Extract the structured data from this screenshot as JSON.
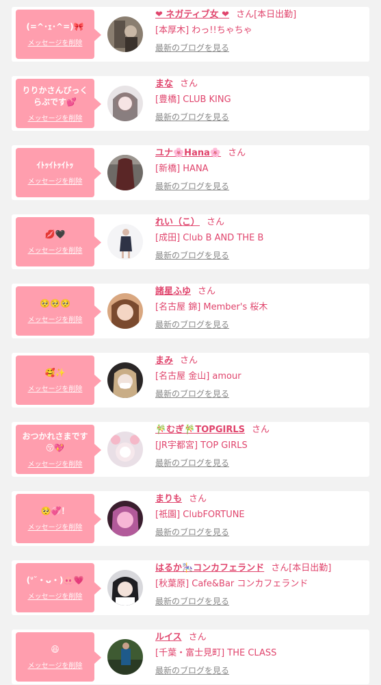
{
  "delete_label": "メッセージを削除",
  "blog_label": "最新のブログを見る",
  "san_label": "さん",
  "colors": {
    "accent": "#e0446c",
    "bubble": "#ff9eae",
    "background": "#f2f2f2",
    "muted": "#888888"
  },
  "cards": [
    {
      "message": "(=^･ｪ･^=)🎀",
      "name": "❤︎ ネガティブ女 ❤︎",
      "suffix": "さん[本日出勤]",
      "shop": "[本厚木] わっ!!ちゃちゃ"
    },
    {
      "message": "りりかさんびっくらぶです💕",
      "name": "まな",
      "suffix": "さん",
      "shop": "[豊橋] CLUB KING"
    },
    {
      "message": "ｲﾄｯｲﾄｯｲﾄｯ",
      "name": "ユナ🌸Hana🌸",
      "suffix": "さん",
      "shop": "[新橋] HANA"
    },
    {
      "message": "💋🖤",
      "name": "れい（こ）",
      "suffix": "さん",
      "shop": "[成田] Club B AND THE B"
    },
    {
      "message": "🥺🥺🥺",
      "name": "諸星ふゆ",
      "suffix": "さん",
      "shop": "[名古屋 錦] Member's 桜木"
    },
    {
      "message": "🥰✨",
      "name": "まみ",
      "suffix": "さん",
      "shop": "[名古屋 金山] amour"
    },
    {
      "message": "おつかれさまです😚💖",
      "name": "🎋むぎ🎋TOPGIRLS",
      "suffix": "さん",
      "shop": "[JR宇都宮] TOP GIRLS"
    },
    {
      "message": "🥺💞！",
      "name": "まりも",
      "suffix": "さん",
      "shop": "[祇園] ClubFORTUNE"
    },
    {
      "message": "(ᐡ˘・ᴗ・)🐽💗",
      "name": "はるか🎠コンカフェランド",
      "suffix": "さん[本日出勤]",
      "shop": "[秋葉原] Cafe&Bar コンカフェランド"
    },
    {
      "message": "😆",
      "name": "ルイス",
      "suffix": "さん",
      "shop": "[千葉・富士見町] THE CLASS"
    }
  ]
}
